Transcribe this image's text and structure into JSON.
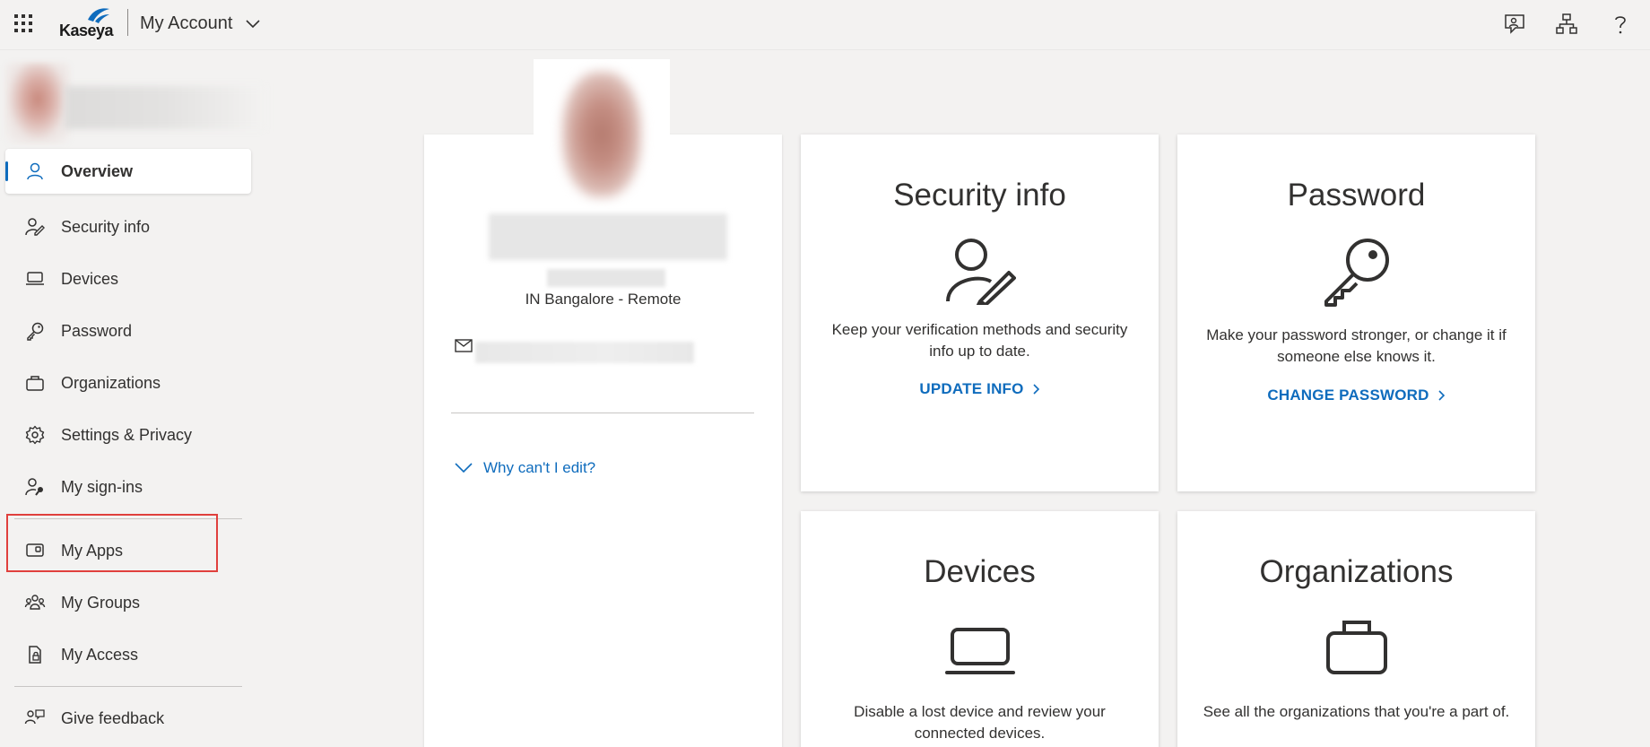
{
  "header": {
    "logo_text": "Kaseya",
    "app_title": "My Account",
    "icons": [
      "feedback-person-icon",
      "org-chart-icon",
      "help-icon"
    ]
  },
  "sidebar": {
    "items": [
      {
        "label": "Overview",
        "icon": "person-icon",
        "active": true
      },
      {
        "label": "Security info",
        "icon": "person-edit-icon"
      },
      {
        "label": "Devices",
        "icon": "laptop-icon"
      },
      {
        "label": "Password",
        "icon": "key-icon"
      },
      {
        "label": "Organizations",
        "icon": "briefcase-icon"
      },
      {
        "label": "Settings & Privacy",
        "icon": "gear-icon"
      },
      {
        "label": "My sign-ins",
        "icon": "person-key-icon"
      },
      {
        "label": "My Apps",
        "icon": "apps-icon"
      },
      {
        "label": "My Groups",
        "icon": "people-icon"
      },
      {
        "label": "My Access",
        "icon": "access-icon"
      },
      {
        "label": "Give feedback",
        "icon": "feedback-icon"
      }
    ]
  },
  "profile": {
    "location": "IN Bangalore - Remote",
    "why_edit": "Why can't I edit?"
  },
  "tiles": {
    "security": {
      "title": "Security info",
      "description": "Keep your verification methods and security info up to date.",
      "link": "UPDATE INFO"
    },
    "password": {
      "title": "Password",
      "description": "Make your password stronger, or change it if someone else knows it.",
      "link": "CHANGE PASSWORD"
    },
    "devices": {
      "title": "Devices",
      "description": "Disable a lost device and review your connected devices."
    },
    "organizations": {
      "title": "Organizations",
      "description": "See all the organizations that you're a part of."
    }
  },
  "colors": {
    "accent": "#0f6cbd",
    "highlight": "#e0403d",
    "background": "#f3f2f1"
  }
}
